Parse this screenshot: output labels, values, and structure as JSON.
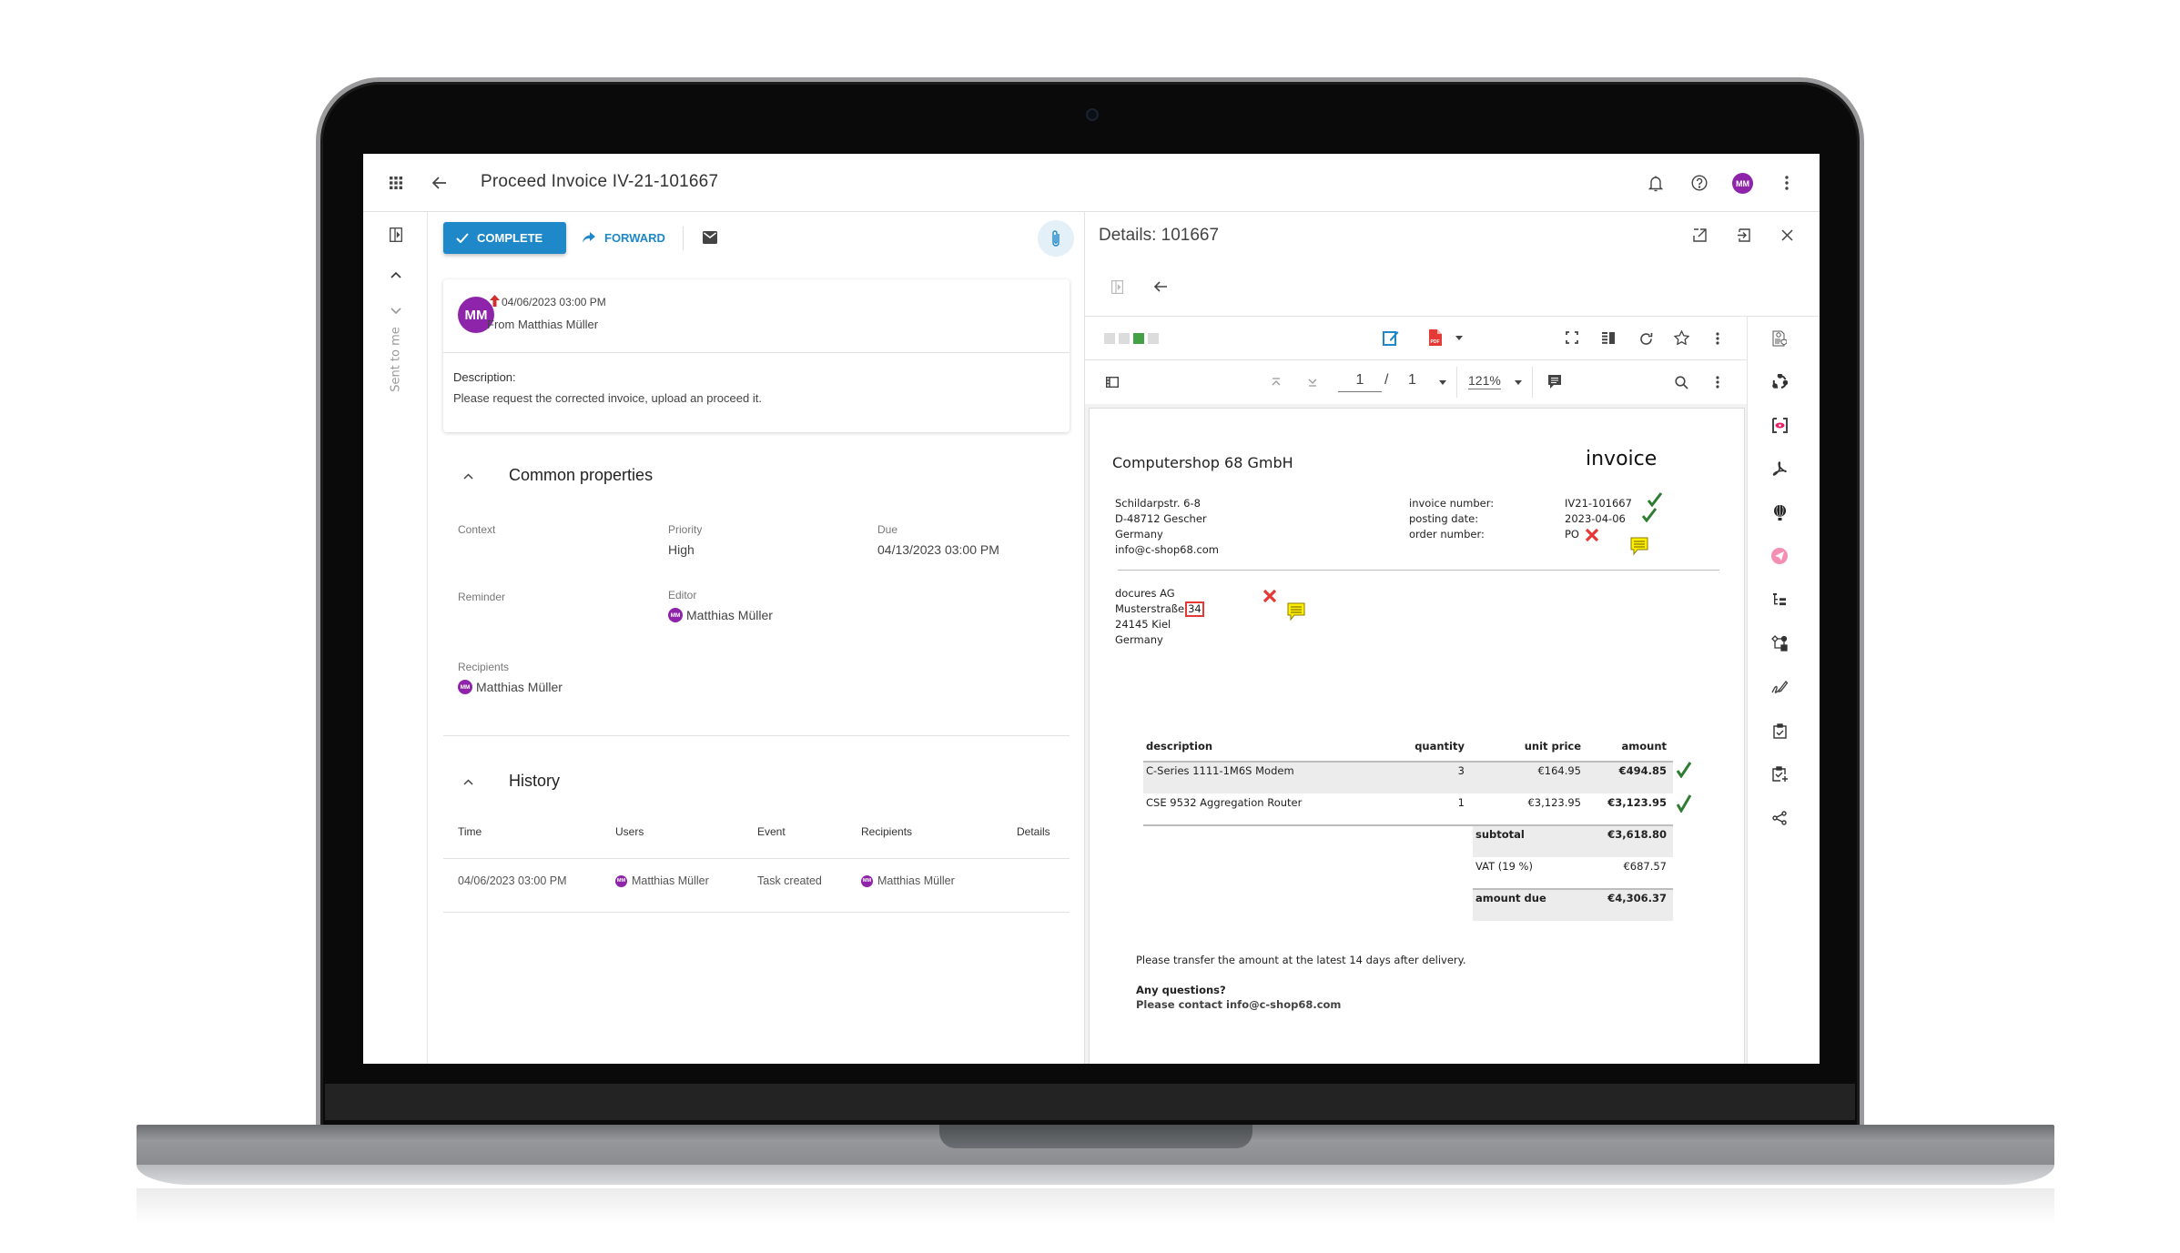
{
  "app": {
    "title": "Proceed Invoice IV-21-101667",
    "user_initials": "MM",
    "avatar_color": "#8e24aa",
    "accent_color": "#1e88c9"
  },
  "header_icons": [
    "apps-grid-icon",
    "back-arrow-icon",
    "bell-icon",
    "help-icon",
    "user-avatar",
    "more-vert-icon"
  ],
  "rail": {
    "vertical_label": "Sent to me"
  },
  "toolbar": {
    "complete_label": "COMPLETE",
    "forward_label": "FORWARD"
  },
  "message": {
    "avatar": "MM",
    "timestamp": "04/06/2023 03:00 PM",
    "from": "From Matthias Müller",
    "description_label": "Description:",
    "description": "Please request the corrected invoice, upload an proceed it."
  },
  "properties": {
    "title": "Common properties",
    "context_label": "Context",
    "priority_label": "Priority",
    "priority_value": "High",
    "due_label": "Due",
    "due_value": "04/13/2023 03:00 PM",
    "reminder_label": "Reminder",
    "editor_label": "Editor",
    "editor_value": "Matthias Müller",
    "recipients_label": "Recipients",
    "recipients_value": "Matthias Müller",
    "avatar_small": "MM"
  },
  "history": {
    "title": "History",
    "columns": [
      "Time",
      "Users",
      "Event",
      "Recipients",
      "Details"
    ],
    "rows": [
      {
        "time": "04/06/2023 03:00 PM",
        "user": "Matthias Müller",
        "event": "Task created",
        "recipient": "Matthias Müller",
        "details": ""
      }
    ]
  },
  "details": {
    "title": "Details: 101667",
    "status_colors": [
      "#dcdcdc",
      "#dcdcdc",
      "#43a047",
      "#dcdcdc"
    ],
    "page_current": "1",
    "page_separator": "/",
    "page_total": "1",
    "zoom": "121%"
  },
  "invoice": {
    "seller_name": "Computershop 68 GmbH",
    "doc_title": "invoice",
    "seller_address": [
      "Schildarpstr. 6-8",
      "D-48712 Gescher",
      "Germany",
      "info@c-shop68.com"
    ],
    "meta_labels": [
      "invoice number:",
      "posting date:",
      "order number:"
    ],
    "meta_values": [
      "IV21-101667",
      "2023-04-06",
      "PO"
    ],
    "meta_status": [
      "valid",
      "valid",
      "invalid"
    ],
    "recipient_address": [
      "docures AG",
      "Musterstraße",
      "24145 Kiel",
      "Germany"
    ],
    "recipient_street_number": "34",
    "table_headers": [
      "description",
      "quantity",
      "unit price",
      "amount"
    ],
    "items": [
      {
        "description": "C-Series 1111-1M6S Modem",
        "quantity": "3",
        "unit_price": "€164.95",
        "amount": "€494.85",
        "status": "valid"
      },
      {
        "description": "CSE 9532 Aggregation Router",
        "quantity": "1",
        "unit_price": "€3,123.95",
        "amount": "€3,123.95",
        "status": "valid"
      }
    ],
    "subtotal_label": "subtotal",
    "subtotal": "€3,618.80",
    "vat_label": "VAT (19 %)",
    "vat": "€687.57",
    "amount_due_label": "amount due",
    "amount_due": "€4,306.37",
    "footer_note": "Please transfer the amount at the latest 14 days after delivery.",
    "questions_label": "Any questions?",
    "contact_line": "Please contact info@c-shop68.com"
  },
  "right_rail_icons": [
    "document-certificate-icon",
    "sync-circle-icon",
    "eye-scan-icon",
    "acrobat-icon",
    "balloon-icon",
    "send-icon",
    "tree-list-icon",
    "workflow-icon",
    "signature-icon",
    "clipboard-check-icon",
    "clipboard-add-icon",
    "share-icon"
  ]
}
